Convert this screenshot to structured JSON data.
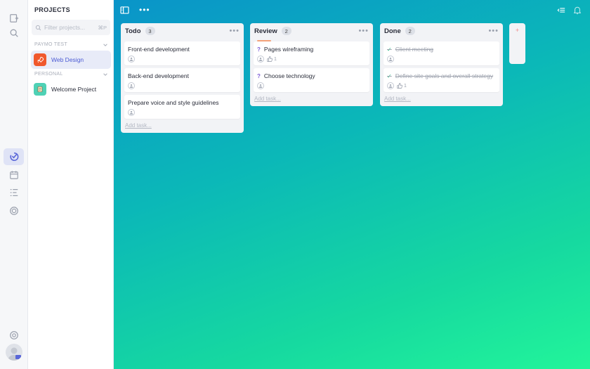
{
  "sidebar": {
    "title": "PROJECTS",
    "search_placeholder": "Filter projects...",
    "search_shortcut": "⌘P",
    "groups": [
      {
        "label": "PAYMO TEST",
        "projects": [
          {
            "name": "Web Design",
            "active": true,
            "icon": "rocket-icon",
            "color": "#f0582d"
          }
        ]
      },
      {
        "label": "PERSONAL",
        "projects": [
          {
            "name": "Welcome Project",
            "active": false,
            "icon": "paper-icon",
            "color": "#4fd1b5"
          }
        ]
      }
    ]
  },
  "board": {
    "columns": [
      {
        "title": "Todo",
        "count": "3",
        "add_label": "Add task...",
        "tasks": [
          {
            "title": "Front-end development",
            "status": "none",
            "likes": ""
          },
          {
            "title": "Back-end development",
            "status": "none",
            "likes": ""
          },
          {
            "title": "Prepare voice and style guidelines",
            "status": "none",
            "likes": ""
          }
        ]
      },
      {
        "title": "Review",
        "count": "2",
        "add_label": "Add task...",
        "tasks": [
          {
            "title": "Pages wireframing",
            "status": "question",
            "likes": "1"
          },
          {
            "title": "Choose technology",
            "status": "question",
            "likes": ""
          }
        ]
      },
      {
        "title": "Done",
        "count": "2",
        "add_label": "Add task...",
        "tasks": [
          {
            "title": "Client meeting",
            "status": "done",
            "likes": ""
          },
          {
            "title": "Define site goals and overall strategy",
            "status": "done",
            "likes": "1"
          }
        ]
      }
    ],
    "add_column_label": "+"
  },
  "colors": {
    "accent": "#5a67d8",
    "question": "#7b5ad6",
    "done": "#2bbf8a",
    "gradient_start": "#0a94c9",
    "gradient_end": "#22f59a"
  }
}
